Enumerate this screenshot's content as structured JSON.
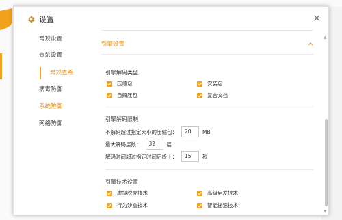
{
  "colors": {
    "accent": "#f0a21d",
    "accent_text": "#e8920f",
    "text": "#333333",
    "divider": "#ececec"
  },
  "dialog": {
    "title": "设置",
    "close_label": "×"
  },
  "sidebar": {
    "items": [
      {
        "label": "常规设置"
      },
      {
        "label": "查杀设置"
      },
      {
        "label": "常规查杀"
      },
      {
        "label": "病毒防御"
      },
      {
        "label": "系统防御"
      },
      {
        "label": "网络防御"
      }
    ]
  },
  "content": {
    "section_title": "引擎设置",
    "collapse_icon": "chevron-up-icon",
    "group_types": {
      "title": "引擎解码类型",
      "options": [
        {
          "label": "压缩包",
          "checked": true
        },
        {
          "label": "安装包",
          "checked": true
        },
        {
          "label": "自解压包",
          "checked": true
        },
        {
          "label": "复合文档",
          "checked": true
        }
      ]
    },
    "group_limits": {
      "title": "引擎解码限制",
      "rows": [
        {
          "label": "不解码超过指定大小的压缩包：",
          "value": "20",
          "unit": "MB"
        },
        {
          "label": "最大解码层数：",
          "value": "32",
          "unit": "层"
        },
        {
          "label": "解码时间超过指定时间后终止：",
          "value": "15",
          "unit": "秒"
        }
      ]
    },
    "group_tech": {
      "title": "引擎技术设置",
      "options": [
        {
          "label": "虚拟脱壳技术",
          "checked": true
        },
        {
          "label": "高级启发技术",
          "checked": true
        },
        {
          "label": "行为沙盒技术",
          "checked": true
        },
        {
          "label": "智能提速技术",
          "checked": true
        }
      ]
    }
  },
  "scrollbar": {
    "up": "▲",
    "down": "▼"
  }
}
